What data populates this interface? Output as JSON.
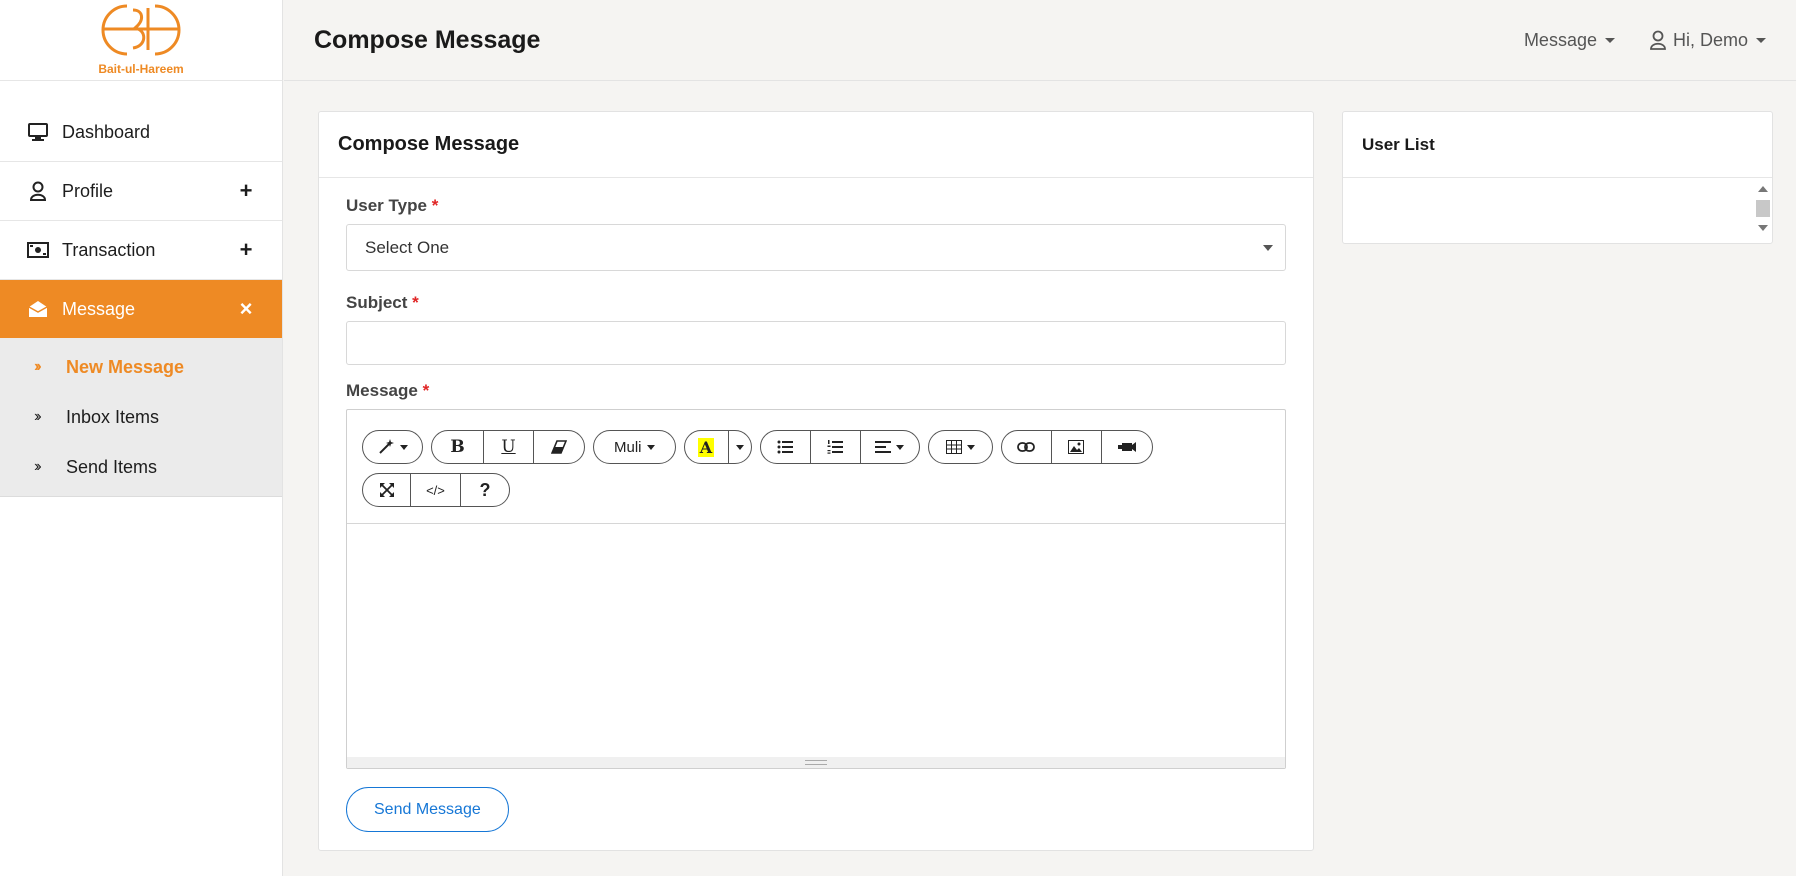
{
  "brand": {
    "name": "Bait-ul-Hareem",
    "accent": "#ee8a24"
  },
  "header": {
    "title": "Compose Message",
    "message_menu": "Message",
    "user_menu": "Hi, Demo"
  },
  "sidebar": {
    "items": [
      {
        "label": "Dashboard",
        "icon": "monitor-icon",
        "toggle": ""
      },
      {
        "label": "Profile",
        "icon": "user-icon",
        "toggle": "+"
      },
      {
        "label": "Transaction",
        "icon": "money-icon",
        "toggle": "+"
      },
      {
        "label": "Message",
        "icon": "envelope-open-icon",
        "toggle": "×",
        "active": true
      }
    ],
    "submenu": [
      {
        "label": "New Message",
        "current": true
      },
      {
        "label": "Inbox Items"
      },
      {
        "label": "Send Items"
      }
    ]
  },
  "compose": {
    "title": "Compose Message",
    "user_type": {
      "label": "User Type",
      "required": "*",
      "selected": "Select One"
    },
    "subject": {
      "label": "Subject",
      "required": "*",
      "value": ""
    },
    "message": {
      "label": "Message",
      "required": "*"
    },
    "toolbar": {
      "font": "Muli",
      "bold": "B",
      "underline": "U",
      "highlight": "A",
      "help": "?"
    },
    "send_label": "Send Message"
  },
  "user_list": {
    "title": "User List"
  }
}
